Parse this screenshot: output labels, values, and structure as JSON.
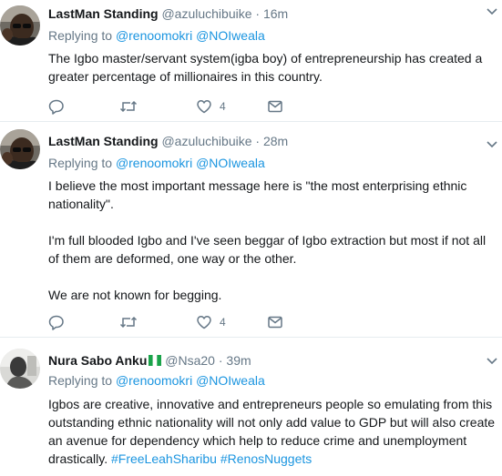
{
  "tweets": [
    {
      "name": "LastMan Standing",
      "handle": "@azuluchibuike",
      "separator": "·",
      "time": "16m",
      "replying_prefix": "Replying to",
      "mention1": "@renoomokri",
      "mention2": "@NOIweala",
      "paragraphs": [
        "The Igbo master/servant system(igba boy) of entrepreneurship has created a greater percentage of millionaires in this country."
      ],
      "like_count": "4"
    },
    {
      "name": "LastMan Standing",
      "handle": "@azuluchibuike",
      "separator": "·",
      "time": "28m",
      "replying_prefix": "Replying to",
      "mention1": "@renoomokri",
      "mention2": "@NOIweala",
      "paragraphs": [
        "I believe the most important message here is \"the most enterprising ethnic nationality\".",
        "I'm full blooded Igbo and I've  seen beggar of Igbo extraction but most if not all of them are deformed, one way or the other.",
        "We are not known for begging."
      ],
      "like_count": "4"
    },
    {
      "name": "Nura Sabo Anku",
      "handle": "@Nsa20",
      "separator": "·",
      "time": "39m",
      "replying_prefix": "Replying to",
      "mention1": "@renoomokri",
      "mention2": "@NOIweala",
      "body_text": "Igbos are creative, innovative and entrepreneurs people so emulating from this outstanding ethnic nationality will not only add value to GDP but will also create an avenue for dependency which help to reduce crime and unemployment drastically.",
      "hashtag1": "#FreeLeahSharibu",
      "hashtag2": "#RenosNuggets"
    }
  ],
  "icons": {
    "reply": "reply-icon",
    "retweet": "retweet-icon",
    "like": "heart-icon",
    "dm": "envelope-icon",
    "more": "chevron-down-icon",
    "flag": "nigeria-flag-icon"
  },
  "colors": {
    "link": "#1b95e0",
    "muted": "#657786",
    "text": "#14171a"
  }
}
